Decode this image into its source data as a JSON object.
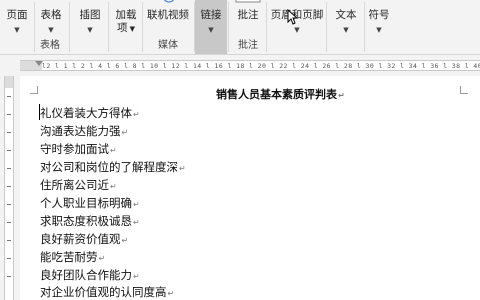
{
  "ribbon": {
    "buttons": [
      {
        "key": "page",
        "label": "页面",
        "has_caret": true
      },
      {
        "key": "table",
        "label": "表格",
        "has_caret": true
      },
      {
        "key": "illustrations",
        "label": "插图",
        "has_caret": true
      },
      {
        "key": "addins",
        "label": "加载",
        "label2": "项",
        "has_caret": true
      },
      {
        "key": "online_video",
        "label": "联机视频",
        "has_caret": false
      },
      {
        "key": "link",
        "label": "链接",
        "has_caret": true
      },
      {
        "key": "comment",
        "label": "批注",
        "has_caret": false
      },
      {
        "key": "header_footer",
        "label": "页眉和页脚",
        "has_caret": true
      },
      {
        "key": "text",
        "label": "文本",
        "has_caret": true
      },
      {
        "key": "symbols",
        "label": "符号",
        "has_caret": true
      }
    ],
    "groups": {
      "table": "表格",
      "media": "媒体",
      "comment": "批注"
    }
  },
  "ruler": {
    "ticks": "l2 l 1 l 2 l 4 l 6 l 8 l 10 l 12 l 14 l 16 l 18 l 20 l 22 l 24 l 26 l 28 l 30 l 32 l 34 l 36 l 38 l 40 l 42 l 44 l 46"
  },
  "document": {
    "title": "销售人员基本素质评判表",
    "paragraph_mark": "↵",
    "lines": [
      "礼仪着装大方得体",
      "沟通表达能力强",
      "守时参加面试",
      "对公司和岗位的了解程度深",
      "住所离公司近",
      "个人职业目标明确",
      "求职态度积极诚恳",
      "良好薪资价值观",
      "能吃苦耐劳",
      "良好团队合作能力",
      "对企业价值观的认同度高"
    ]
  },
  "colors": {
    "ribbon_bg": "#f3f3f3",
    "pressed_button": "#c8c8c8",
    "page_bg": "#ffffff",
    "text": "#111111"
  }
}
